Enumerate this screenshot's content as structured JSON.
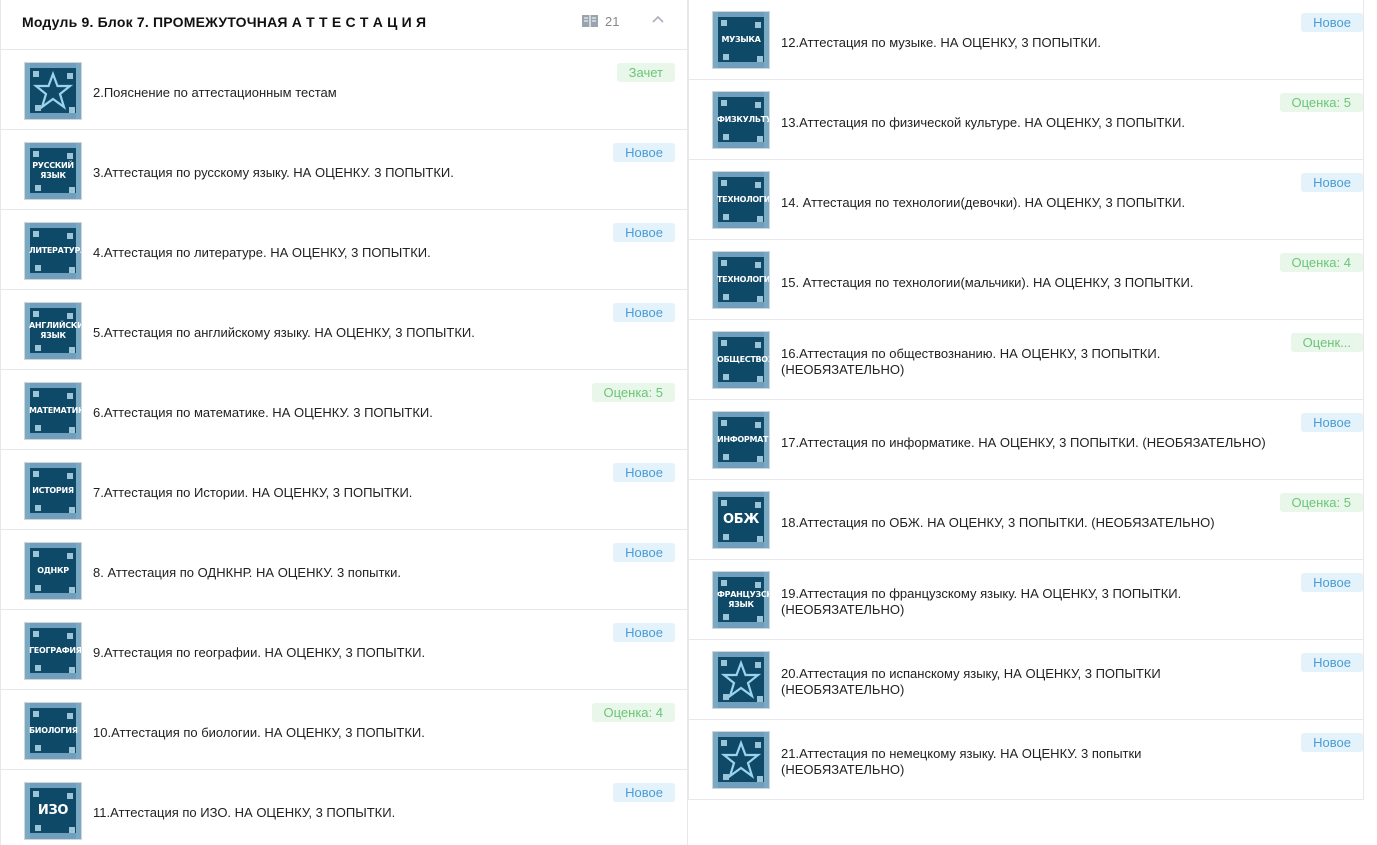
{
  "header": {
    "title": "Модуль 9. Блок 7. ПРОМЕЖУТОЧНАЯ А Т Т Е С Т А Ц И Я",
    "count": "21",
    "book_icon": "book-icon",
    "collapse_icon": "chevron-up-icon"
  },
  "colors": {
    "new_badge_bg": "#e4f2fb",
    "new_badge_text": "#4a9cd4",
    "grade_badge_bg": "#e8f7ea",
    "grade_badge_text": "#6cc478",
    "thumb_bg": "#0e4a68"
  },
  "left_items": [
    {
      "thumb": "",
      "thumb_icon": "star-icon",
      "title": "2.Пояснение по аттестационным тестам",
      "badge": "Зачет",
      "badge_type": "grade"
    },
    {
      "thumb": "РУССКИЙ ЯЗЫК",
      "title": "3.Аттестация по русскому языку. НА ОЦЕНКУ. 3 ПОПЫТКИ.",
      "badge": "Новое",
      "badge_type": "new"
    },
    {
      "thumb": "ЛИТЕРАТУРА",
      "title": "4.Аттестация по литературе. НА ОЦЕНКУ, 3 ПОПЫТКИ.",
      "badge": "Новое",
      "badge_type": "new"
    },
    {
      "thumb": "АНГЛИЙСКИЙ ЯЗЫК",
      "title": "5.Аттестация по английскому языку. НА ОЦЕНКУ, 3 ПОПЫТКИ.",
      "badge": "Новое",
      "badge_type": "new"
    },
    {
      "thumb": "МАТЕМАТИКА",
      "title": "6.Аттестация по математике. НА ОЦЕНКУ. 3 ПОПЫТКИ.",
      "badge": "Оценка: 5",
      "badge_type": "grade"
    },
    {
      "thumb": "ИСТОРИЯ",
      "title": "7.Аттестация по Истории. НА ОЦЕНКУ, 3 ПОПЫТКИ.",
      "badge": "Новое",
      "badge_type": "new"
    },
    {
      "thumb": "ОДНКР",
      "title": "8. Аттестация по ОДНКНР. НА ОЦЕНКУ. 3 попытки.",
      "badge": "Новое",
      "badge_type": "new"
    },
    {
      "thumb": "ГЕОГРАФИЯ",
      "title": "9.Аттестация по географии. НА ОЦЕНКУ, 3 ПОПЫТКИ.",
      "badge": "Новое",
      "badge_type": "new"
    },
    {
      "thumb": "БИОЛОГИЯ",
      "title": "10.Аттестация по биологии. НА ОЦЕНКУ, 3 ПОПЫТКИ.",
      "badge": "Оценка: 4",
      "badge_type": "grade"
    },
    {
      "thumb": "ИЗО",
      "title": "11.Аттестация по ИЗО. НА ОЦЕНКУ, 3 ПОПЫТКИ.",
      "badge": "Новое",
      "badge_type": "new"
    }
  ],
  "right_items": [
    {
      "thumb": "МУЗЫКА",
      "title": "12.Аттестация по музыке. НА ОЦЕНКУ, 3 ПОПЫТКИ.",
      "title2": "",
      "badge": "Новое",
      "badge_type": "new"
    },
    {
      "thumb": "ФИЗКУЛЬТУРА",
      "title": "13.Аттестация по физической культуре. НА ОЦЕНКУ, 3 ПОПЫТКИ.",
      "title2": "",
      "badge": "Оценка: 5",
      "badge_type": "grade"
    },
    {
      "thumb": "ТЕХНОЛОГИЯ",
      "title": "14. Аттестация по технологии(девочки). НА ОЦЕНКУ, 3 ПОПЫТКИ.",
      "title2": "",
      "badge": "Новое",
      "badge_type": "new"
    },
    {
      "thumb": "ТЕХНОЛОГИЯ",
      "title": "15. Аттестация по технологии(мальчики). НА ОЦЕНКУ, 3 ПОПЫТКИ.",
      "title2": "",
      "badge": "Оценка: 4",
      "badge_type": "grade"
    },
    {
      "thumb": "ОБЩЕСТВОЗНАНИЕ",
      "title": "16.Аттестация по обществознанию. НА ОЦЕНКУ, 3 ПОПЫТКИ.",
      "title2": "(НЕОБЯЗАТЕЛЬНО)",
      "badge": "Оценк...",
      "badge_type": "grade"
    },
    {
      "thumb": "ИНФОРМАТИКА",
      "title": "17.Аттестация по информатике. НА ОЦЕНКУ, 3 ПОПЫТКИ. (НЕОБЯЗАТЕЛЬНО)",
      "title2": "",
      "badge": "Новое",
      "badge_type": "new"
    },
    {
      "thumb": "ОБЖ",
      "title": "18.Аттестация по ОБЖ. НА ОЦЕНКУ, 3 ПОПЫТКИ. (НЕОБЯЗАТЕЛЬНО)",
      "title2": "",
      "badge": "Оценка: 5",
      "badge_type": "grade"
    },
    {
      "thumb": "ФРАНЦУЗСКИЙ ЯЗЫК",
      "title": "19.Аттестация по французскому языку. НА ОЦЕНКУ, 3 ПОПЫТКИ.",
      "title2": "(НЕОБЯЗАТЕЛЬНО)",
      "badge": "Новое",
      "badge_type": "new"
    },
    {
      "thumb": "",
      "thumb_icon": "star-icon",
      "title": "20.Аттестация по испанскому языку, НА ОЦЕНКУ, 3 ПОПЫТКИ",
      "title2": "(НЕОБЯЗАТЕЛЬНО)",
      "badge": "Новое",
      "badge_type": "new"
    },
    {
      "thumb": "",
      "thumb_icon": "star-icon",
      "title": "21.Аттестация по немецкому языку. НА ОЦЕНКУ. 3 попытки",
      "title2": "(НЕОБЯЗАТЕЛЬНО)",
      "badge": "Новое",
      "badge_type": "new"
    }
  ]
}
